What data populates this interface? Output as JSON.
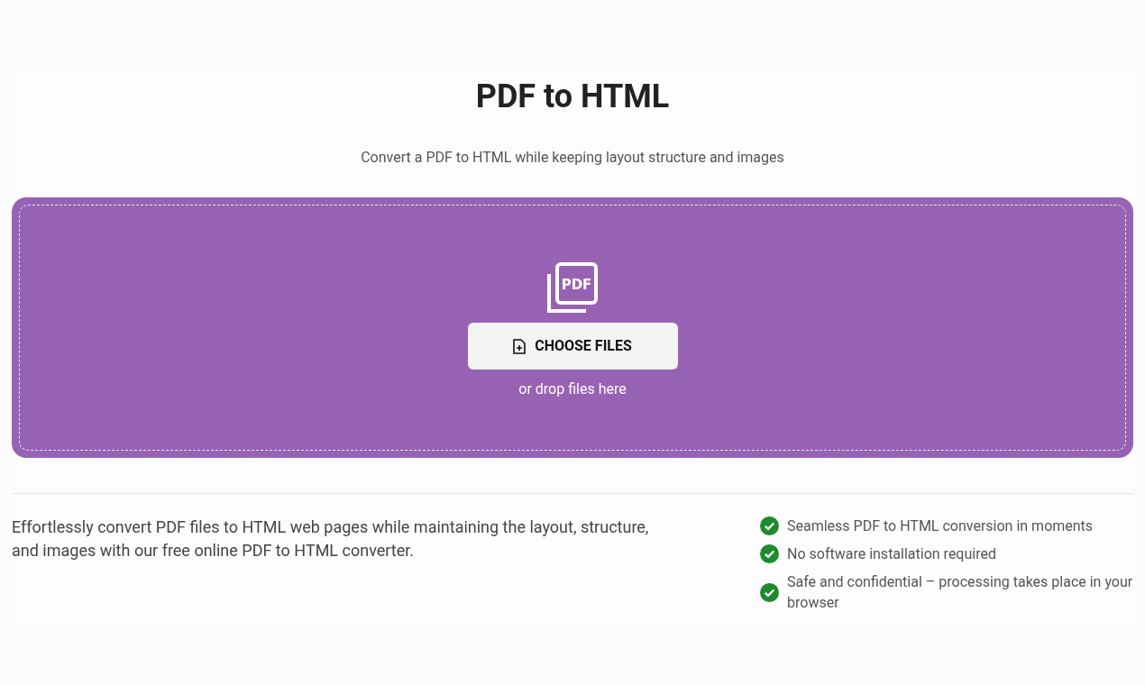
{
  "title": "PDF to HTML",
  "subtitle": "Convert a PDF to HTML while keeping layout structure and images",
  "dropzone": {
    "icon_text": "PDF",
    "button": "CHOOSE FILES",
    "hint": "or drop files here"
  },
  "description": "Effortlessly convert PDF files to HTML web pages while maintaining the layout, structure, and images with our free online PDF to HTML converter.",
  "features": [
    {
      "text": "Seamless PDF to HTML conversion in moments"
    },
    {
      "text": "No software installation required"
    },
    {
      "text": "Safe and confidential – processing takes place in your browser"
    }
  ]
}
